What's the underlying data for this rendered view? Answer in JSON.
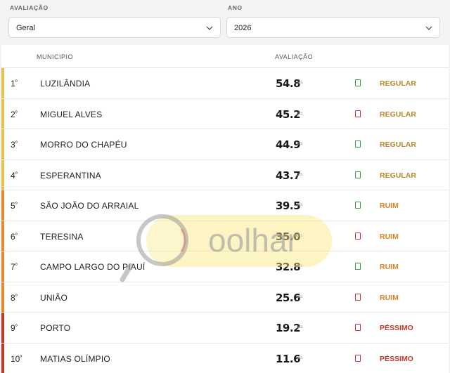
{
  "filters": {
    "avaliacao": {
      "label": "AVALIAÇÃO",
      "value": "Geral"
    },
    "ano": {
      "label": "ANO",
      "value": "2026"
    }
  },
  "table": {
    "headers": {
      "municipio": "MUNICIPIO",
      "avaliacao": "AVALIAÇÃO"
    },
    "rows": [
      {
        "rank": "1",
        "city": "LUZILÂNDIA",
        "score": "54.8",
        "pts": "pts",
        "trend": "up",
        "status": "REGULAR",
        "bar": "#e2c24c",
        "statusColor": "#b7892a"
      },
      {
        "rank": "2",
        "city": "MIGUEL ALVES",
        "score": "45.2",
        "pts": "pts",
        "trend": "down",
        "status": "REGULAR",
        "bar": "#e2c24c",
        "statusColor": "#b7892a"
      },
      {
        "rank": "3",
        "city": "MORRO DO CHAPÉU",
        "score": "44.9",
        "pts": "pts",
        "trend": "up",
        "status": "REGULAR",
        "bar": "#e2c24c",
        "statusColor": "#b7892a"
      },
      {
        "rank": "4",
        "city": "ESPERANTINA",
        "score": "43.7",
        "pts": "pts",
        "trend": "up",
        "status": "REGULAR",
        "bar": "#e2c24c",
        "statusColor": "#b7892a"
      },
      {
        "rank": "5",
        "city": "SÃO JOÃO DO ARRAIAL",
        "score": "39.5",
        "pts": "pts",
        "trend": "up",
        "status": "RUIM",
        "bar": "#e08a2a",
        "statusColor": "#d88420"
      },
      {
        "rank": "6",
        "city": "TERESINA",
        "score": "35.0",
        "pts": "pts",
        "trend": "down",
        "status": "RUIM",
        "bar": "#e08a2a",
        "statusColor": "#d88420"
      },
      {
        "rank": "7",
        "city": "CAMPO LARGO DO PIAUÍ",
        "score": "32.8",
        "pts": "pts",
        "trend": "up",
        "status": "RUIM",
        "bar": "#e08a2a",
        "statusColor": "#d88420"
      },
      {
        "rank": "8",
        "city": "UNIÃO",
        "score": "25.6",
        "pts": "pts",
        "trend": "down",
        "status": "RUIM",
        "bar": "#e08a2a",
        "statusColor": "#d88420"
      },
      {
        "rank": "9",
        "city": "PORTO",
        "score": "19.2",
        "pts": "pts",
        "trend": "down",
        "status": "PÉSSIMO",
        "bar": "#c0392b",
        "statusColor": "#c0392b"
      },
      {
        "rank": "10",
        "city": "MATIAS OLÍMPIO",
        "score": "11.6",
        "pts": "pts",
        "trend": "down",
        "status": "PÉSSIMO",
        "bar": "#c0392b",
        "statusColor": "#c0392b"
      }
    ]
  },
  "watermark": {
    "text": "oolhar"
  }
}
